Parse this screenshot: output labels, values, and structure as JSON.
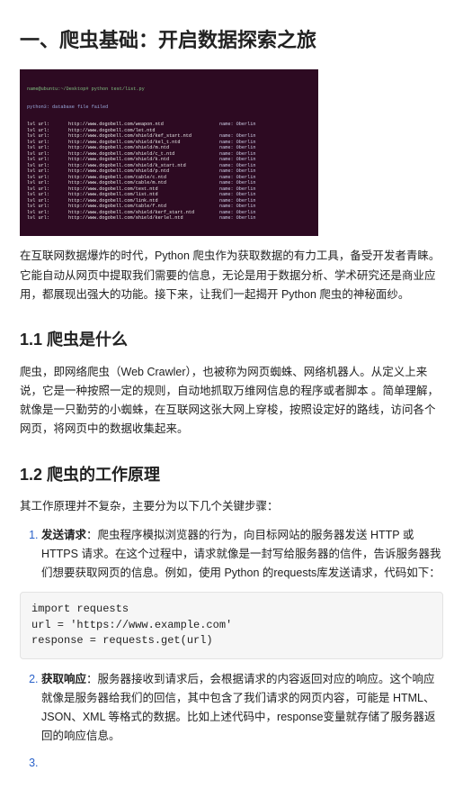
{
  "h1": "一、爬虫基础：开启数据探索之旅",
  "terminal": {
    "header1": "name@ubuntu:~/Desktop# python test/list.py",
    "header2": "python3: database file failed",
    "rows": [
      {
        "lvl": "lvl url:",
        "url": "http://www.dogobell.com/weapon.ntd",
        "name": "name: Oberlin"
      },
      {
        "lvl": "lvl url:",
        "url": "http://www.dogobell.com/let.ntd",
        "name": ""
      },
      {
        "lvl": "lvl url:",
        "url": "http://www.dogobell.com/shield/kef_start.ntd",
        "name": "name: Oberlin"
      },
      {
        "lvl": "lvl url:",
        "url": "http://www.dogobell.com/shield/kel_t.ntd",
        "name": "name: Oberlin"
      },
      {
        "lvl": "lvl url:",
        "url": "http://www.dogobell.com/shield/m.ntd",
        "name": "name: Oberlin"
      },
      {
        "lvl": "lvl url:",
        "url": "http://www.dogobell.com/shield/c_t.ntd",
        "name": "name: Oberlin"
      },
      {
        "lvl": "lvl url:",
        "url": "http://www.dogobell.com/shield/k.ntd",
        "name": "name: Oberlin"
      },
      {
        "lvl": "lvl url:",
        "url": "http://www.dogobell.com/shield/k_start.ntd",
        "name": "name: Oberlin"
      },
      {
        "lvl": "lvl url:",
        "url": "http://www.dogobell.com/shield/p.ntd",
        "name": "name: Oberlin"
      },
      {
        "lvl": "lvl url:",
        "url": "http://www.dogobell.com/cable/c.ntd",
        "name": "name: Oberlin"
      },
      {
        "lvl": "lvl url:",
        "url": "http://www.dogobell.com/cable/m.ntd",
        "name": "name: Oberlin"
      },
      {
        "lvl": "lvl url:",
        "url": "http://www.dogobell.com/test.ntd",
        "name": "name: Oberlin"
      },
      {
        "lvl": "lvl url:",
        "url": "http://www.dogobell.com/list.ntd",
        "name": "name: Oberlin"
      },
      {
        "lvl": "lvl url:",
        "url": "http://www.dogobell.com/link.ntd",
        "name": "name: Oberlin"
      },
      {
        "lvl": "lvl url:",
        "url": "http://www.dogobell.com/table/f.ntd",
        "name": "name: Oberlin"
      },
      {
        "lvl": "lvl url:",
        "url": "http://www.dogobell.com/shield/kerf_start.ntd",
        "name": "name: Oberlin"
      },
      {
        "lvl": "lvl url:",
        "url": "http://www.dogobell.com/shield/kerlel.ntd",
        "name": "name: Oberlin"
      }
    ]
  },
  "intro": "在互联网数据爆炸的时代，Python 爬虫作为获取数据的有力工具，备受开发者青睐。它能自动从网页中提取我们需要的信息，无论是用于数据分析、学术研究还是商业应用，都展现出强大的功能。接下来，让我们一起揭开 Python 爬虫的神秘面纱。",
  "h2a": "1.1 爬虫是什么",
  "sec1": "爬虫，即网络爬虫（Web Crawler），也被称为网页蜘蛛、网络机器人。从定义上来说，它是一种按照一定的规则，自动地抓取万维网信息的程序或者脚本 。简单理解，就像是一只勤劳的小蜘蛛，在互联网这张大网上穿梭，按照设定好的路线，访问各个网页，将网页中的数据收集起来。",
  "h2b": "1.2 爬虫的工作原理",
  "sec2_intro": "其工作原理并不复杂，主要分为以下几个关键步骤：",
  "li1_head": "发送请求",
  "li1_body": "：爬虫程序模拟浏览器的行为，向目标网站的服务器发送 HTTP 或 HTTPS 请求。在这个过程中，请求就像是一封写给服务器的信件，告诉服务器我们想要获取网页的信息。例如，使用 Python 的requests库发送请求，代码如下：",
  "code1": "import requests\nurl = 'https://www.example.com'\nresponse = requests.get(url)",
  "li2_head": "获取响应",
  "li2_body": "：服务器接收到请求后，会根据请求的内容返回对应的响应。这个响应就像是服务器给我们的回信，其中包含了我们请求的网页内容，可能是 HTML、JSON、XML 等格式的数据。比如上述代码中，response变量就存储了服务器返回的响应信息。",
  "li3_body": ""
}
